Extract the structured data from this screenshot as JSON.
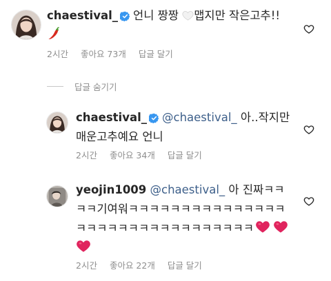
{
  "comments": [
    {
      "username": "chaestival_",
      "text_before": "언니 짱짱",
      "text_after": "맵지만 작은고추!!",
      "emojis": [
        "white-heart",
        "chili-pepper"
      ],
      "time": "2시간",
      "likes": "좋아요 73개",
      "reply": "답글 달기",
      "verified": true
    },
    {
      "username": "chaestival_",
      "mention": "@chaestival_",
      "text": "아..작지만 매운고추예요 언니",
      "time": "2시간",
      "likes": "좋아요 34개",
      "reply": "답글 달기",
      "verified": true
    },
    {
      "username": "yeojin1009",
      "mention": "@chaestival_",
      "text_line1": "아 진짜ㅋㅋ",
      "text_line2": "ㅋㅋ기여워ㅋㅋㅋㅋㅋㅋㅋㅋㅋㅋㅋㅋㅋㅋㅋ",
      "text_line3": "ㅋㅋㅋㅋㅋㅋㅋㅋㅋㅋㅋㅋㅋㅋㅋㅋㅋ",
      "emojis": [
        "red-heart",
        "red-heart",
        "red-heart"
      ],
      "time": "2시간",
      "likes": "좋아요 22개",
      "reply": "답글 달기",
      "verified": false
    }
  ],
  "hide_replies": "답글 숨기기",
  "colors": {
    "text": "#262626",
    "meta": "#8e8e8e",
    "mention": "#3d5f8a",
    "verified": "#3897f0",
    "heart": "#e0245e"
  }
}
